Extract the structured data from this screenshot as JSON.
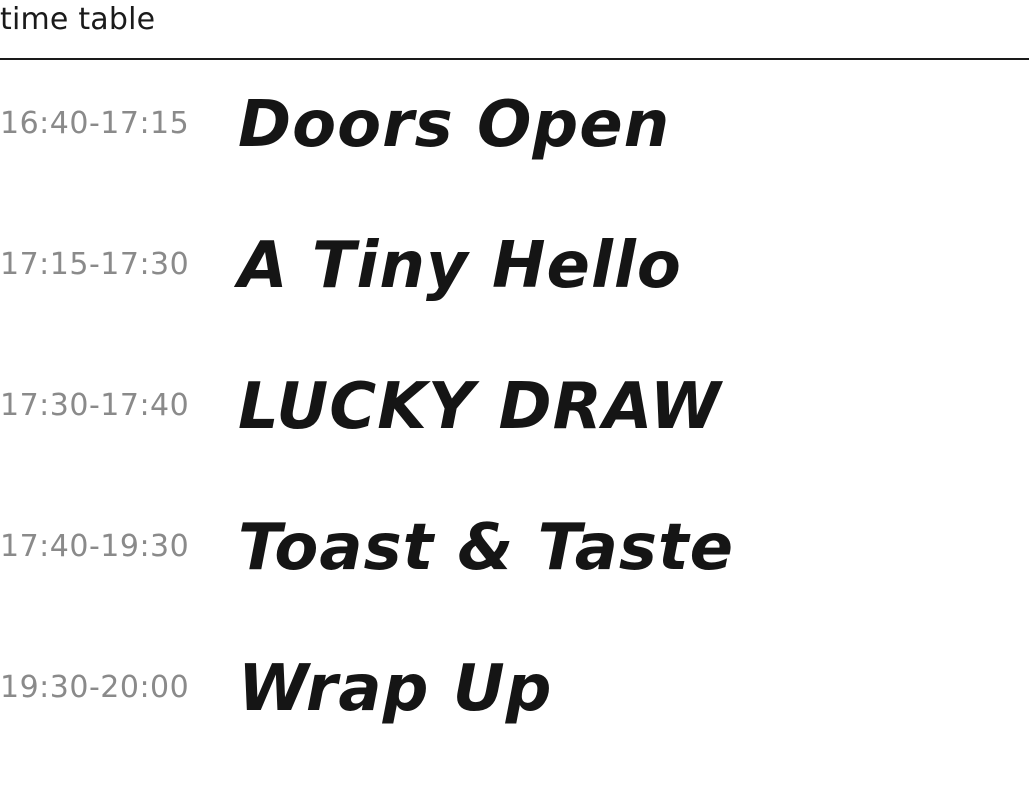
{
  "header": {
    "title": "time table"
  },
  "schedule": [
    {
      "time": "16:40-17:15",
      "event": "Doors Open"
    },
    {
      "time": "17:15-17:30",
      "event": "A Tiny Hello"
    },
    {
      "time": "17:30-17:40",
      "event": "LUCKY DRAW"
    },
    {
      "time": "17:40-19:30",
      "event": "Toast & Taste"
    },
    {
      "time": "19:30-20:00",
      "event": "Wrap Up"
    }
  ],
  "colors": {
    "title": "#1a1a1a",
    "time": "#8a8a8a",
    "event": "#151515",
    "divider": "#1a1a1a",
    "background": "#ffffff"
  }
}
